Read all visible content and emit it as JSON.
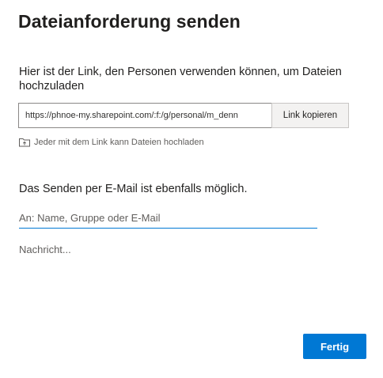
{
  "dialog": {
    "title": "Dateianforderung senden",
    "link_intro": "Hier ist der Link, den Personen verwenden können, um Dateien hochzuladen",
    "link_value": "https://phnoe-my.sharepoint.com/:f:/g/personal/m_denn",
    "copy_button_label": "Link kopieren",
    "permission_icon": "folder-upload-icon",
    "permission_text": "Jeder mit dem Link kann Dateien hochladen",
    "email_intro": "Das Senden per E-Mail ist ebenfalls möglich.",
    "to_placeholder": "An: Name, Gruppe oder E-Mail",
    "message_placeholder": "Nachricht...",
    "done_button_label": "Fertig"
  },
  "colors": {
    "accent": "#0078d4",
    "text_primary": "#201f1e",
    "text_secondary": "#605e5c"
  }
}
